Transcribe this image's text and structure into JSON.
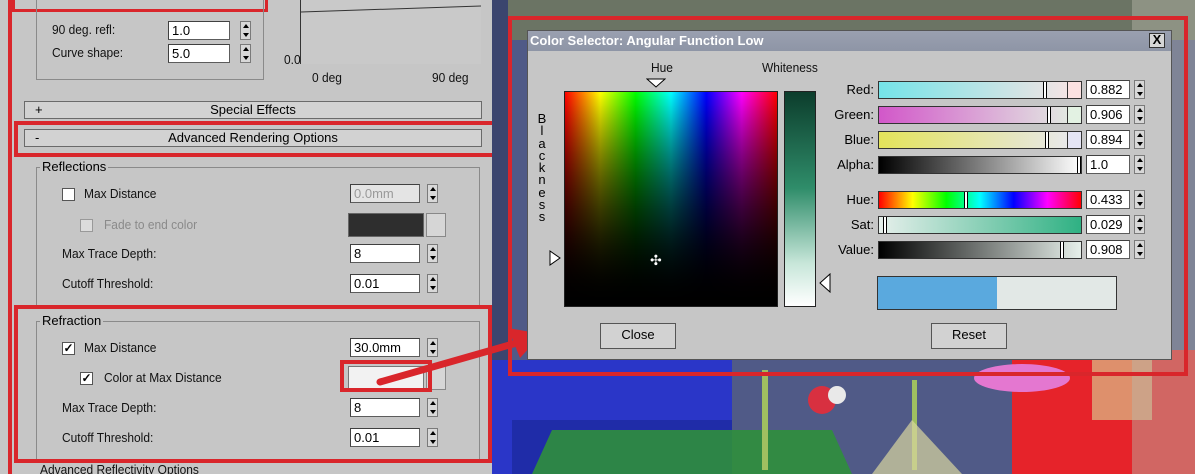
{
  "material_panel": {
    "falloff": {
      "refl_90_label": "90 deg. refl:",
      "refl_90_value": "1.0",
      "curve_shape_label": "Curve shape:",
      "curve_shape_value": "5.0",
      "graph_y_min": "0.0",
      "graph_x_min": "0 deg",
      "graph_x_max": "90 deg"
    },
    "rollouts": {
      "special_effects": {
        "sign": "+",
        "label": "Special Effects"
      },
      "advanced_rendering": {
        "sign": "-",
        "label": "Advanced Rendering Options"
      },
      "advanced_reflectivity": {
        "label": "Advanced Reflectivity Options"
      }
    },
    "reflections": {
      "group_label": "Reflections",
      "max_distance_label": "Max Distance",
      "max_distance_checked": false,
      "max_distance_value": "0.0mm",
      "fade_label": "Fade to end color",
      "fade_color": "#2e2e2e",
      "max_trace_label": "Max Trace Depth:",
      "max_trace_value": "8",
      "cutoff_label": "Cutoff Threshold:",
      "cutoff_value": "0.01"
    },
    "refraction": {
      "group_label": "Refraction",
      "max_distance_label": "Max Distance",
      "max_distance_checked": true,
      "max_distance_value": "30.0mm",
      "color_label": "Color at Max Distance",
      "color_checked": true,
      "color_swatch": "#f2f2f2",
      "max_trace_label": "Max Trace Depth:",
      "max_trace_value": "8",
      "cutoff_label": "Cutoff Threshold:",
      "cutoff_value": "0.01"
    }
  },
  "color_selector": {
    "title": "Color Selector: Angular Function Low",
    "close_x": "X",
    "hue_label": "Hue",
    "whiteness_label": "Whiteness",
    "blackness_label": "B\nl\na\nc\nk\nn\ne\ns\ns",
    "channels": [
      {
        "label": "Red:",
        "value": "0.882"
      },
      {
        "label": "Green:",
        "value": "0.906"
      },
      {
        "label": "Blue:",
        "value": "0.894"
      },
      {
        "label": "Alpha:",
        "value": "1.0"
      },
      {
        "label": "Hue:",
        "value": "0.433"
      },
      {
        "label": "Sat:",
        "value": "0.029"
      },
      {
        "label": "Value:",
        "value": "0.908"
      }
    ],
    "old_color": "#5aa9de",
    "new_color": "#e2e8e6",
    "close_label": "Close",
    "reset_label": "Reset"
  },
  "colors": {
    "highlight_red": "#d9262b",
    "panel_gray": "#c6c6c6"
  }
}
